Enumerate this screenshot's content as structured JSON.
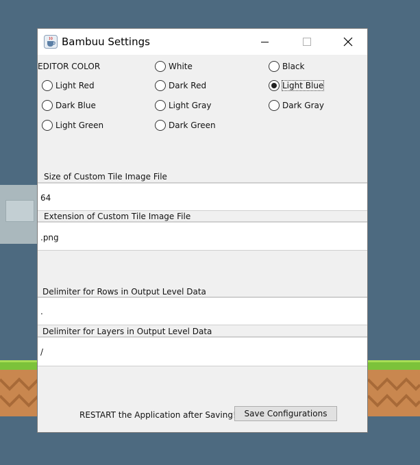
{
  "window": {
    "title": "Bambuu Settings",
    "app_icon": "java-cup-icon"
  },
  "editor_color": {
    "heading": "EDITOR COLOR",
    "options": [
      {
        "label": "White",
        "selected": false
      },
      {
        "label": "Black",
        "selected": false
      },
      {
        "label": "Light Red",
        "selected": false
      },
      {
        "label": "Dark Red",
        "selected": false
      },
      {
        "label": "Light Blue",
        "selected": true
      },
      {
        "label": "Dark Blue",
        "selected": false
      },
      {
        "label": "Light Gray",
        "selected": false
      },
      {
        "label": "Dark Gray",
        "selected": false
      },
      {
        "label": "Light Green",
        "selected": false
      },
      {
        "label": "Dark Green",
        "selected": false
      }
    ]
  },
  "fields": {
    "tile_size": {
      "label": "Size of Custom Tile Image File",
      "value": "64"
    },
    "tile_extension": {
      "label": "Extension of Custom Tile Image File",
      "value": ".png"
    },
    "row_delimiter": {
      "label": "Delimiter for Rows in Output Level Data",
      "value": "."
    },
    "layer_delimiter": {
      "label": "Delimiter for Layers in Output Level Data",
      "value": "/"
    }
  },
  "footer": {
    "note": "RESTART the Application after Saving!",
    "save_label": "Save Configurations"
  },
  "colors": {
    "desktop_bg": "#4d6a80",
    "window_bg": "#f0f0f0",
    "grass": "#7cc23a",
    "dirt": "#c9874f"
  }
}
